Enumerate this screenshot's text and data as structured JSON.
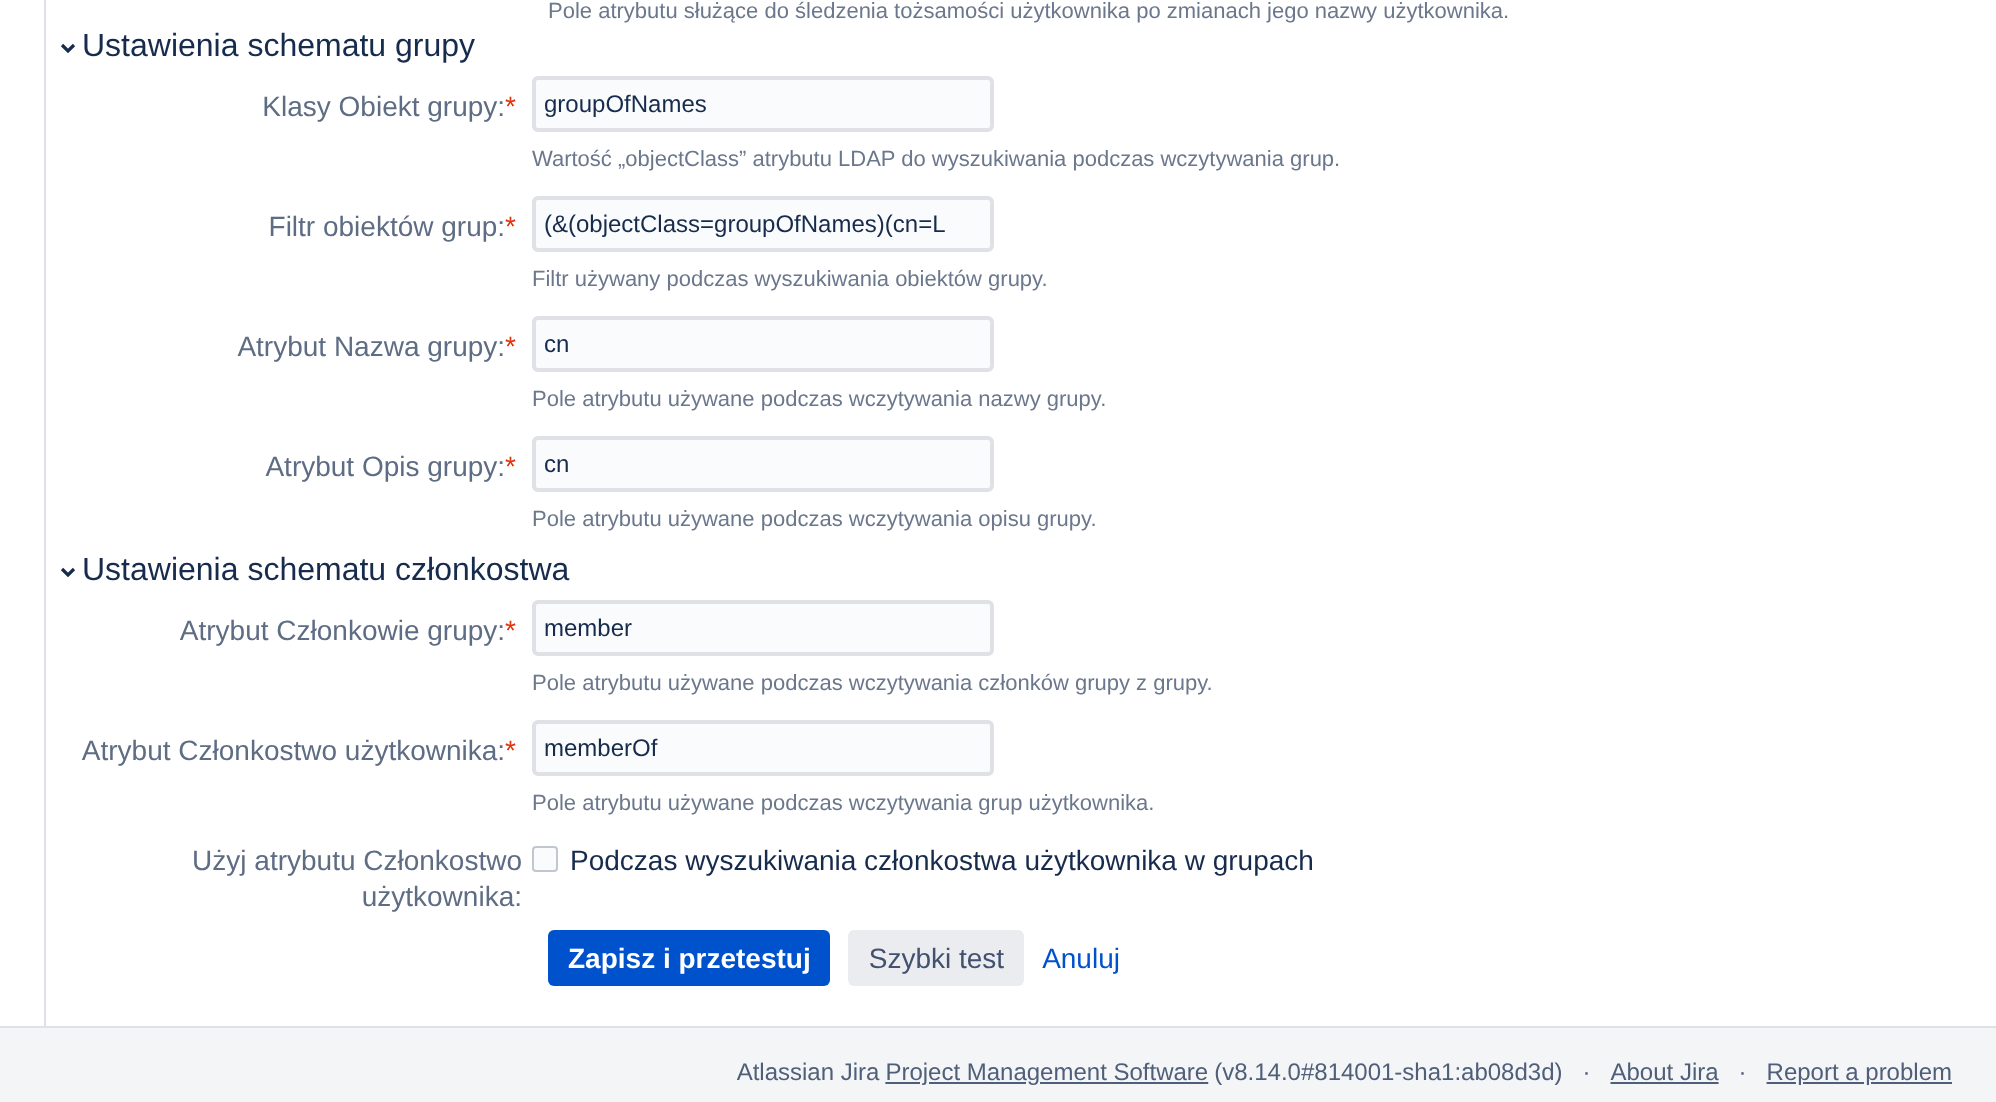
{
  "top_note": "Pole atrybutu służące do śledzenia tożsamości użytkownika po zmianach jego nazwy użytkownika.",
  "sections": [
    {
      "title": "Ustawienia schematu grupy",
      "expanded": true,
      "fields": [
        {
          "label": "Klasy Obiekt grupy:",
          "mark": "*",
          "value": "groupOfNames",
          "help": "Wartość „objectClass” atrybutu LDAP do wyszukiwania podczas wczytywania grup."
        },
        {
          "label": "Filtr obiektów grup:",
          "mark": "*",
          "value": "(&(objectClass=groupOfNames)(cn=L",
          "help": "Filtr używany podczas wyszukiwania obiektów grupy."
        },
        {
          "label": "Atrybut Nazwa grupy:",
          "mark": "*",
          "value": "cn",
          "help": "Pole atrybutu używane podczas wczytywania nazwy grupy."
        },
        {
          "label": "Atrybut Opis grupy:",
          "mark": "*",
          "value": "cn",
          "help": "Pole atrybutu używane podczas wczytywania opisu grupy."
        }
      ]
    },
    {
      "title": "Ustawienia schematu członkostwa",
      "expanded": true,
      "fields": [
        {
          "label": "Atrybut Członkowie grupy:",
          "mark": "*",
          "value": "member",
          "help": "Pole atrybutu używane podczas wczytywania członków grupy z grupy."
        },
        {
          "label": "Atrybut Członkostwo użytkownika:",
          "mark": "*",
          "value": "memberOf",
          "help": "Pole atrybutu używane podczas wczytywania grup użytkownika."
        }
      ]
    }
  ],
  "checkbox_row": {
    "label": "Użyj atrybutu Członkostwo użytkownika:",
    "text": "Podczas wyszukiwania członkostwa użytkownika w grupach",
    "checked": false
  },
  "buttons": [
    {
      "label": "Zapisz i przetestuj",
      "kind": "primary"
    },
    {
      "label": "Szybki test",
      "kind": "secondary"
    },
    {
      "label": "Anuluj",
      "kind": "link"
    }
  ],
  "footer": {
    "prefix": "Atlassian Jira",
    "link": "Project Management Software",
    "version": "(v8.14.0#814001-sha1:ab08d3d)",
    "separator": "·",
    "links": [
      "About Jira",
      "Report a problem"
    ]
  }
}
